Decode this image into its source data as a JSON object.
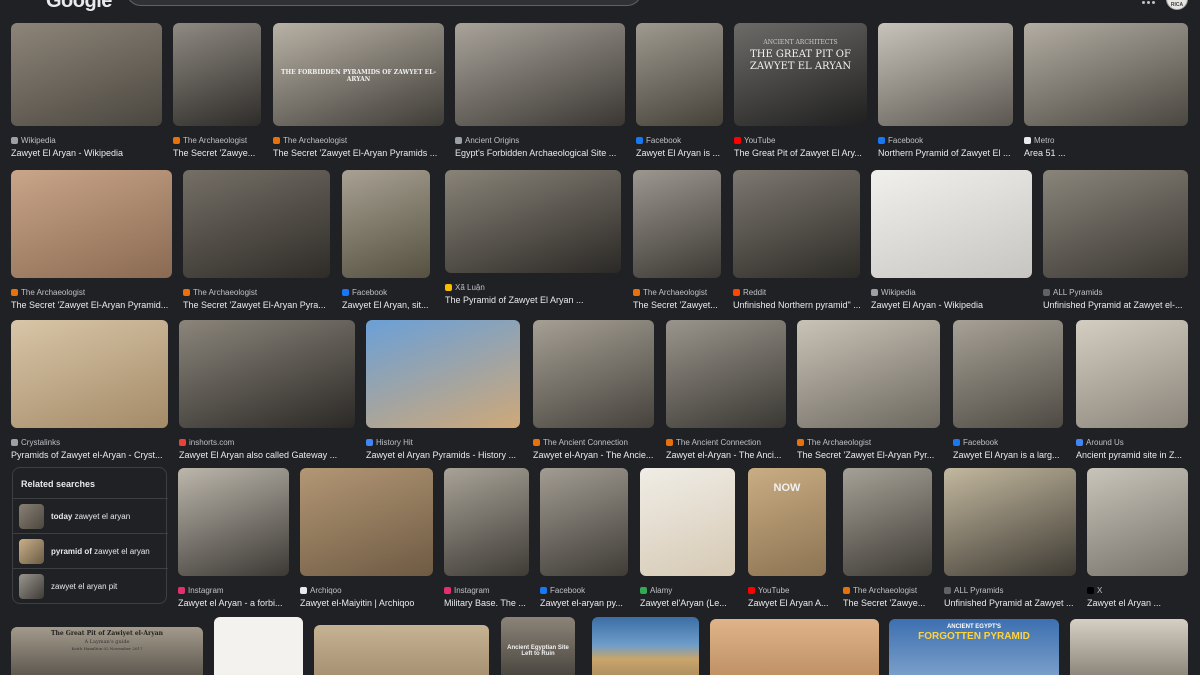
{
  "header": {
    "logo": "Google",
    "avatar_text": "RICA"
  },
  "results": [
    {
      "source": "Wikipedia",
      "title": "Zawyet El Aryan - Wikipedia",
      "fav": "#9aa0a6"
    },
    {
      "source": "The Archaeologist",
      "title": "The Secret 'Zawye...",
      "fav": "#e8710a"
    },
    {
      "source": "The Archaeologist",
      "title": "The Secret 'Zawyet El-Aryan Pyramids ...",
      "fav": "#e8710a",
      "overlay": "THE FORBIDDEN PYRAMIDS OF ZAWYET EL-ARYAN"
    },
    {
      "source": "Ancient Origins",
      "title": "Egypt's Forbidden Archaeological Site ...",
      "fav": "#9aa0a6"
    },
    {
      "source": "Facebook",
      "title": "Zawyet El Aryan is ...",
      "fav": "#1877f2"
    },
    {
      "source": "YouTube",
      "title": "The Great Pit of Zawyet El Ary...",
      "fav": "#ff0000",
      "overlay_small": "ANCIENT ARCHITECTS",
      "overlay": "THE GREAT PIT OF ZAWYET EL ARYAN"
    },
    {
      "source": "Facebook",
      "title": "Northern Pyramid of Zawyet El ...",
      "fav": "#1877f2"
    },
    {
      "source": "Metro",
      "title": "Area 51 ...",
      "fav": "#e8eaed"
    },
    {
      "source": "The Archaeologist",
      "title": "The Secret 'Zawyet El-Aryan Pyramid...",
      "fav": "#e8710a"
    },
    {
      "source": "The Archaeologist",
      "title": "The Secret 'Zawyet El-Aryan Pyra...",
      "fav": "#e8710a"
    },
    {
      "source": "Facebook",
      "title": "Zawyet El Aryan, sit...",
      "fav": "#1877f2"
    },
    {
      "source": "Xã Luận",
      "title": "The Pyramid of Zawyet El Aryan ...",
      "fav": "#fbbc04"
    },
    {
      "source": "The Archaeologist",
      "title": "The Secret 'Zawyet...",
      "fav": "#e8710a"
    },
    {
      "source": "Reddit",
      "title": "Unfinished Northern pyramid\" ...",
      "fav": "#ff4500"
    },
    {
      "source": "Wikipedia",
      "title": "Zawyet El Aryan - Wikipedia",
      "fav": "#9aa0a6"
    },
    {
      "source": "ALL Pyramids",
      "title": "Unfinished Pyramid at Zawyet el-...",
      "fav": "#5f6368"
    },
    {
      "source": "Crystalinks",
      "title": "Pyramids of Zawyet el-Aryan - Cryst...",
      "fav": "#9aa0a6"
    },
    {
      "source": "inshorts.com",
      "title": "Zawyet El Aryan also called Gateway ...",
      "fav": "#ea4335"
    },
    {
      "source": "History Hit",
      "title": "Zawyet el Aryan Pyramids - History ...",
      "fav": "#4285f4"
    },
    {
      "source": "The Ancient Connection",
      "title": "Zawyet el-Aryan - The Ancie...",
      "fav": "#e8710a"
    },
    {
      "source": "The Ancient Connection",
      "title": "Zawyet el-Aryan - The Anci...",
      "fav": "#e8710a"
    },
    {
      "source": "The Archaeologist",
      "title": "The Secret 'Zawyet El-Aryan Pyr...",
      "fav": "#e8710a"
    },
    {
      "source": "Facebook",
      "title": "Zawyet El Aryan is a larg...",
      "fav": "#1877f2"
    },
    {
      "source": "Around Us",
      "title": "Ancient pyramid site in Z...",
      "fav": "#4285f4"
    },
    {
      "source": "Instagram",
      "title": "Zawyet el Aryan - a forbi...",
      "fav": "#e1306c"
    },
    {
      "source": "Archiqoo",
      "title": "Zawyet el-Maiyitin | Archiqoo",
      "fav": "#e8eaed"
    },
    {
      "source": "Instagram",
      "title": "Military Base. The ...",
      "fav": "#e1306c"
    },
    {
      "source": "Facebook",
      "title": "Zawyet el-aryan py...",
      "fav": "#1877f2"
    },
    {
      "source": "Alamy",
      "title": "Zawyet el'Aryan (Le...",
      "fav": "#34a853"
    },
    {
      "source": "YouTube",
      "title": "Zawyet El Aryan A...",
      "fav": "#ff0000",
      "overlay": "NOW"
    },
    {
      "source": "The Archaeologist",
      "title": "The Secret 'Zawye...",
      "fav": "#e8710a"
    },
    {
      "source": "ALL Pyramids",
      "title": "Unfinished Pyramid at Zawyet ...",
      "fav": "#5f6368"
    },
    {
      "source": "X",
      "title": "Zawyet el Aryan ...",
      "fav": "#000000"
    }
  ],
  "related": {
    "heading": "Related searches",
    "items": [
      {
        "bold": "today",
        "rest": " zawyet el aryan"
      },
      {
        "bold": "pyramid of",
        "rest": " zawyet el aryan"
      },
      {
        "bold": "",
        "rest": "zawyet el aryan pit"
      }
    ]
  },
  "bottom_row": {
    "great_pit_title": "The Great Pit of Zawiyet el-Aryan",
    "great_pit_sub": "A Layman's guide",
    "great_pit_date": "Keith Hamilton 02 November 2017",
    "ancient_site": "Ancient Egyptian Site Left to Ruin",
    "ancient_egypt": "ANCIENT EGYPT'S",
    "forgotten": "FORGOTTEN PYRAMID"
  }
}
